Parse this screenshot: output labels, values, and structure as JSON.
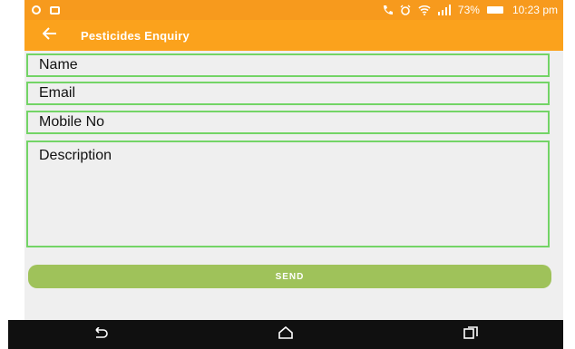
{
  "status_bar": {
    "battery": "73%",
    "time": "10:23 pm",
    "icons": [
      "circle-notification-icon",
      "screen-icon",
      "phone-icon",
      "alarm-icon",
      "wifi-icon",
      "signal-icon",
      "battery-icon"
    ]
  },
  "app_bar": {
    "title": "Pesticides Enquiry",
    "back_icon": "arrow-left-icon"
  },
  "form": {
    "name_placeholder": "Name",
    "email_placeholder": "Email",
    "mobile_placeholder": "Mobile No",
    "description_placeholder": "Description",
    "send_label": "SEND"
  },
  "nav_bar": {
    "icons": [
      "back-icon",
      "home-icon",
      "recents-icon"
    ]
  },
  "colors": {
    "status_bar": "#f79a1d",
    "app_bar": "#fba21c",
    "field_border": "#73d466",
    "send_button": "#9fc25a",
    "nav_bar": "#101010",
    "content_bg": "#efefef"
  }
}
